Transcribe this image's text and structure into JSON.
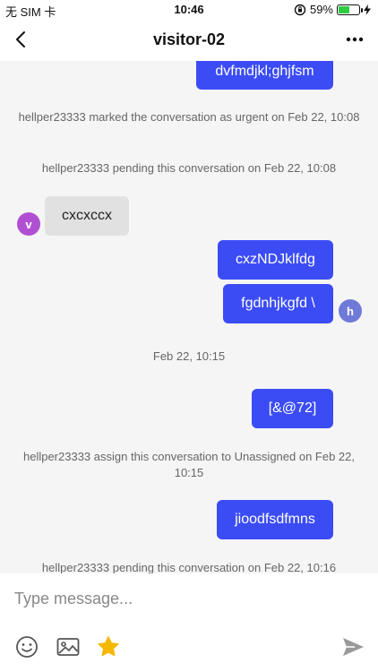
{
  "status_bar": {
    "carrier": "无 SIM 卡",
    "time": "10:46",
    "battery_percent": "59%",
    "battery_level": 0.59
  },
  "header": {
    "title": "visitor-02",
    "back_icon": "chevron-left-icon",
    "more_icon": "more-horizontal-icon"
  },
  "messages": [
    {
      "type": "outgoing",
      "text": "dvfmdjkl;ghjfsm"
    },
    {
      "type": "system",
      "text": "hellper23333 marked the conversation as urgent on Feb 22, 10:08"
    },
    {
      "type": "system",
      "text": "hellper23333 pending this conversation on Feb 22, 10:08"
    },
    {
      "type": "incoming",
      "text": "cxcxccx",
      "avatar": "v"
    },
    {
      "type": "outgoing",
      "text": "cxzNDJklfdg"
    },
    {
      "type": "outgoing",
      "text": "fgdnhjkgfd \\",
      "avatar": "h"
    },
    {
      "type": "system",
      "text": "Feb 22, 10:15"
    },
    {
      "type": "outgoing",
      "text": "[&@72]"
    },
    {
      "type": "system",
      "text": "hellper23333 assign this conversation to Unassigned on Feb 22, 10:15"
    },
    {
      "type": "outgoing",
      "text": "jioodfsdfmns"
    },
    {
      "type": "system",
      "text": "hellper23333 pending this conversation on Feb 22, 10:16"
    }
  ],
  "composer": {
    "placeholder": "Type message...",
    "tools": [
      "emoji-icon",
      "image-icon",
      "star-icon"
    ],
    "send_icon": "send-icon"
  },
  "colors": {
    "outgoing_bubble": "#3b4cf5",
    "incoming_bubble": "#e1e1e1",
    "chat_background": "#f5f5f5",
    "visitor_avatar": "#b04fd2",
    "agent_avatar": "#6f7ad8",
    "star": "#f5b800"
  }
}
